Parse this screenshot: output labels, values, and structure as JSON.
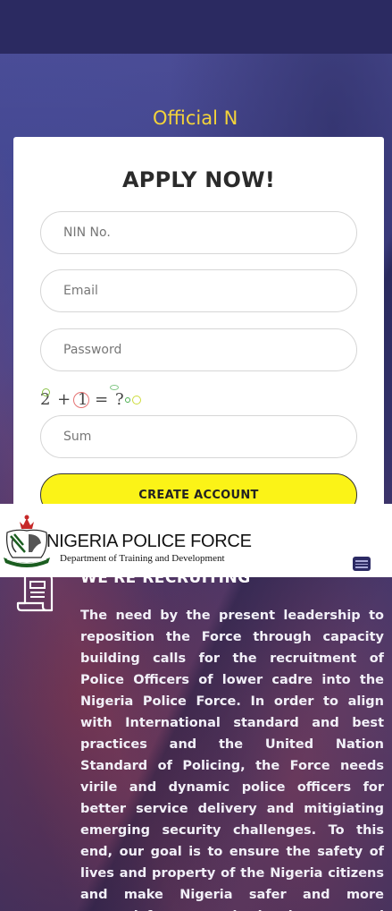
{
  "hero": {
    "title": "Official N"
  },
  "form": {
    "title": "APPLY NOW!",
    "nin_placeholder": "NIN No.",
    "email_placeholder": "Email",
    "password_placeholder": "Password",
    "captcha_text": "2 + 1 = ?",
    "sum_placeholder": "Sum",
    "submit_label": "CREATE ACCOUNT"
  },
  "navbar": {
    "brand_name": "NIGERIA POLICE FORCE",
    "brand_subtitle": "Department of Training and Development",
    "logo_icon": "police-crest-icon",
    "menu_icon": "hamburger-menu-icon"
  },
  "recruiting": {
    "icon": "document-icon",
    "title": "WE'RE RECRUITING",
    "body": "The need by the present leadership to reposition the Force through capacity building calls for the recruitment of Police Officers of lower cadre into the Nigeria Police Force. In order to align with International standard and best practices and the United Nation Standard of Policing, the Force needs virile and dynamic police officers for better service delivery and mitigiating emerging security challenges. To this end, our goal is to ensure the safety of lives and property of the Nigeria citizens and make Nigeria safer and more secured for economic development and growth."
  },
  "colors": {
    "topbar": "#2b2a61",
    "accent_yellow": "#fbf317",
    "hero_title": "#f3d33a"
  }
}
